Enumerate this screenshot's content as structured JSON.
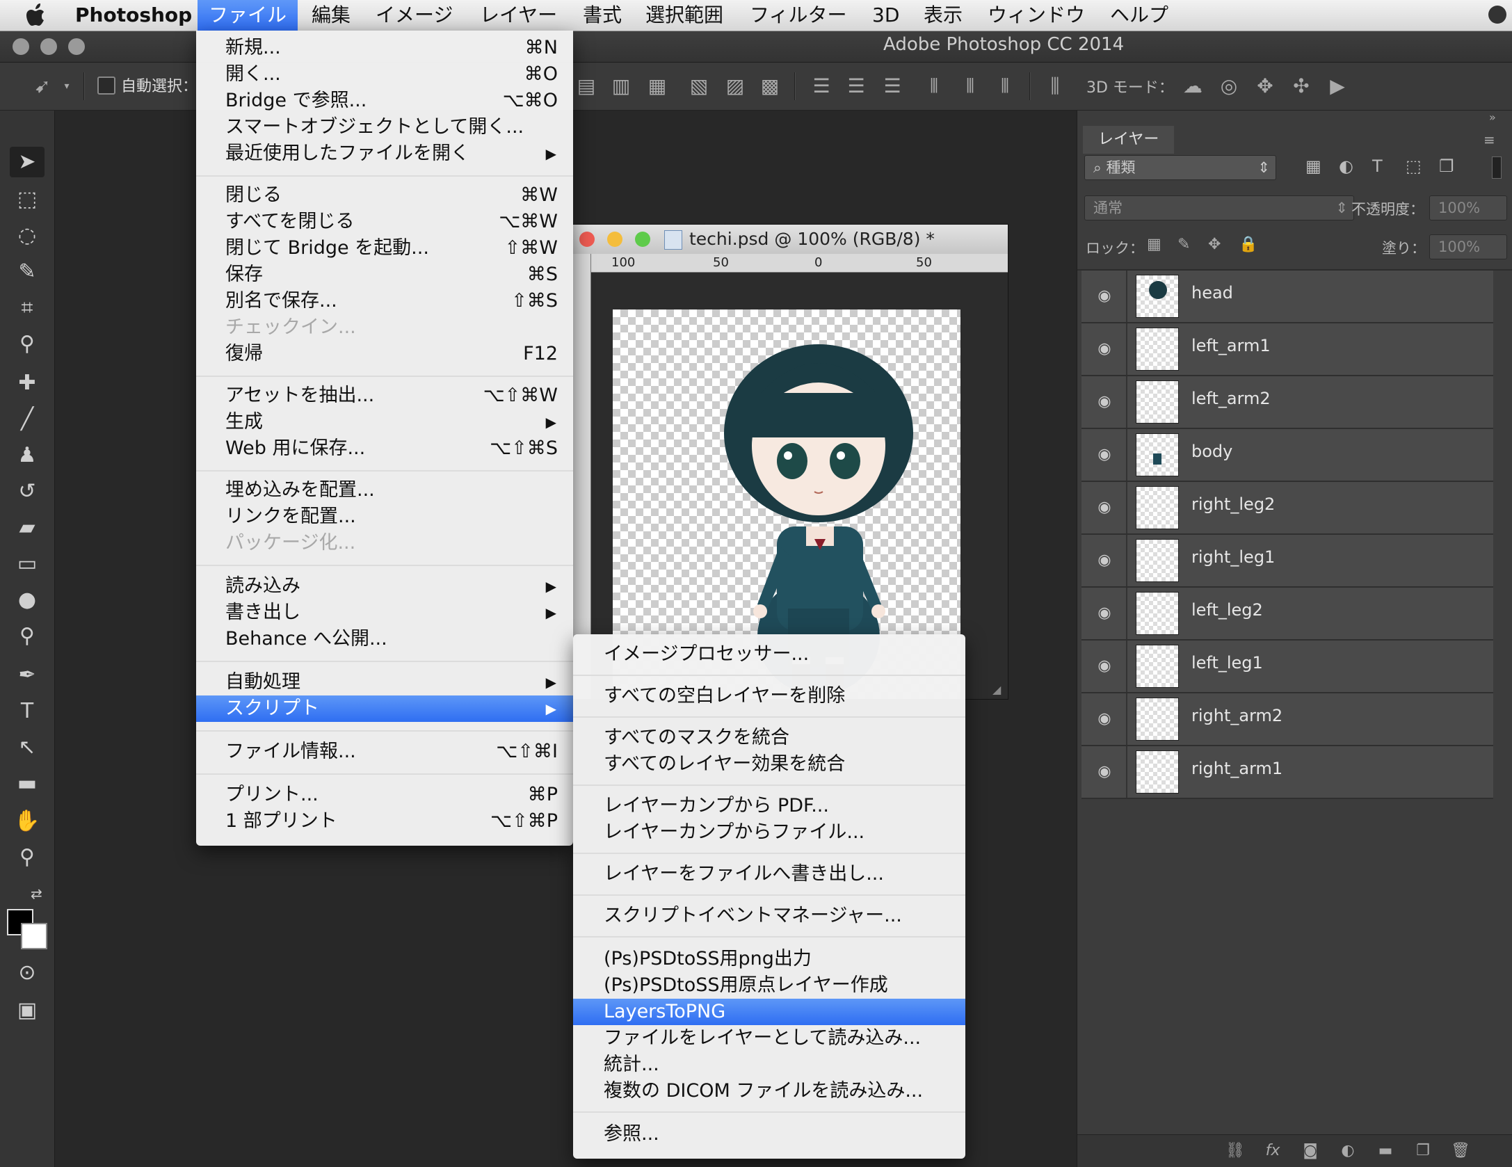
{
  "menubar": {
    "app_name": "Photoshop",
    "items": [
      "ファイル",
      "編集",
      "イメージ",
      "レイヤー",
      "書式",
      "選択範囲",
      "フィルター",
      "3D",
      "表示",
      "ウィンドウ",
      "ヘルプ"
    ],
    "active_item": "ファイル"
  },
  "window": {
    "title": "Adobe Photoshop CC 2014"
  },
  "options_bar": {
    "auto_select_label": "自動選択：",
    "mode_3d_label": "3D モード："
  },
  "file_menu": {
    "items": [
      {
        "label": "新規...",
        "shortcut": "⌘N"
      },
      {
        "label": "開く...",
        "shortcut": "⌘O"
      },
      {
        "label": "Bridge で参照...",
        "shortcut": "⌥⌘O"
      },
      {
        "label": "スマートオブジェクトとして開く...",
        "shortcut": ""
      },
      {
        "label": "最近使用したファイルを開く",
        "shortcut": "▶"
      },
      {
        "label": "閉じる",
        "shortcut": "⌘W"
      },
      {
        "label": "すべてを閉じる",
        "shortcut": "⌥⌘W"
      },
      {
        "label": "閉じて Bridge を起動...",
        "shortcut": "⇧⌘W"
      },
      {
        "label": "保存",
        "shortcut": "⌘S"
      },
      {
        "label": "別名で保存...",
        "shortcut": "⇧⌘S"
      },
      {
        "label": "チェックイン...",
        "shortcut": ""
      },
      {
        "label": "復帰",
        "shortcut": "F12"
      },
      {
        "label": "アセットを抽出...",
        "shortcut": "⌥⇧⌘W"
      },
      {
        "label": "生成",
        "shortcut": "▶"
      },
      {
        "label": "Web 用に保存...",
        "shortcut": "⌥⇧⌘S"
      },
      {
        "label": "埋め込みを配置...",
        "shortcut": ""
      },
      {
        "label": "リンクを配置...",
        "shortcut": ""
      },
      {
        "label": "パッケージ化...",
        "shortcut": ""
      },
      {
        "label": "読み込み",
        "shortcut": "▶"
      },
      {
        "label": "書き出し",
        "shortcut": "▶"
      },
      {
        "label": "Behance へ公開...",
        "shortcut": ""
      },
      {
        "label": "自動処理",
        "shortcut": "▶"
      },
      {
        "label": "スクリプト",
        "shortcut": "▶"
      },
      {
        "label": "ファイル情報...",
        "shortcut": "⌥⇧⌘I"
      },
      {
        "label": "プリント...",
        "shortcut": "⌘P"
      },
      {
        "label": "1 部プリント",
        "shortcut": "⌥⇧⌘P"
      }
    ]
  },
  "script_menu": {
    "items": [
      "イメージプロセッサー...",
      "すべての空白レイヤーを削除",
      "すべてのマスクを統合",
      "すべてのレイヤー効果を統合",
      "レイヤーカンプから PDF...",
      "レイヤーカンプからファイル...",
      "レイヤーをファイルへ書き出し...",
      "スクリプトイベントマネージャー...",
      "(Ps)PSDtoSS用png出力",
      "(Ps)PSDtoSS用原点レイヤー作成",
      "LayersToPNG",
      "ファイルをレイヤーとして読み込み...",
      "統計...",
      "複数の DICOM ファイルを読み込み...",
      "参照..."
    ],
    "highlighted": "LayersToPNG"
  },
  "document": {
    "title": "techi.psd @ 100% (RGB/8) *",
    "ruler_ticks": [
      "100",
      "50",
      "0",
      "50"
    ]
  },
  "layers_panel": {
    "tab_label": "レイヤー",
    "filter_kind": "種類",
    "blend_mode": "通常",
    "opacity_label": "不透明度：",
    "opacity_value": "100%",
    "lock_label": "ロック：",
    "fill_label": "塗り：",
    "fill_value": "100%",
    "layers": [
      "head",
      "left_arm1",
      "left_arm2",
      "body",
      "right_leg2",
      "right_leg1",
      "left_leg2",
      "left_leg1",
      "right_arm2",
      "right_arm1"
    ]
  },
  "colors": {
    "highlight": "#3a78f3",
    "panel_bg": "#3c3c3c",
    "canvas_bg": "#282828"
  }
}
